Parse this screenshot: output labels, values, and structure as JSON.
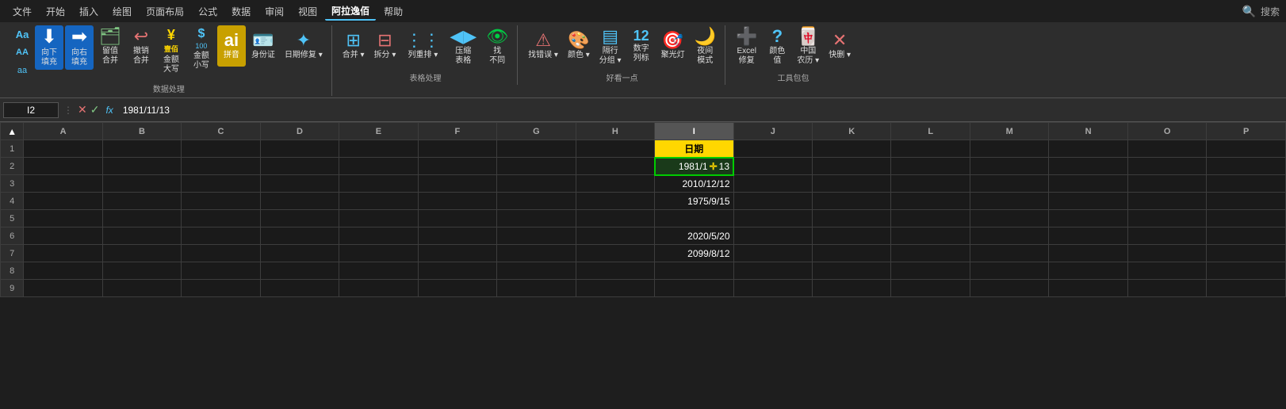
{
  "menubar": {
    "items": [
      "文件",
      "开始",
      "插入",
      "绘图",
      "页面布局",
      "公式",
      "数据",
      "审阅",
      "视图",
      "阿拉逸佰",
      "帮助"
    ],
    "active": "阿拉逸佰",
    "search_placeholder": "搜索"
  },
  "ribbon": {
    "groups": [
      {
        "label": "数据处理",
        "buttons": [
          {
            "id": "fill-down",
            "icon": "⬇",
            "label": "向下\n填充",
            "color": "blue",
            "size": "large"
          },
          {
            "id": "fill-right",
            "icon": "➡",
            "label": "向右\n填充",
            "color": "blue",
            "size": "large"
          },
          {
            "id": "retain-merge",
            "icon": "📋",
            "label": "留值\n合并",
            "color": "green",
            "size": "large"
          },
          {
            "id": "undo-merge",
            "icon": "↩",
            "label": "撤销\n合并",
            "color": "red",
            "size": "large"
          },
          {
            "id": "amount-upper",
            "icon": "¥",
            "label": "金额\n大写",
            "color": "",
            "size": "large"
          },
          {
            "id": "amount-lower",
            "icon": "$",
            "label": "金额\n小写",
            "color": "",
            "size": "large"
          },
          {
            "id": "pinyin",
            "icon": "ai",
            "label": "拼音",
            "color": "gold",
            "size": "large",
            "gold": true
          },
          {
            "id": "id-card",
            "icon": "🪪",
            "label": "身份证",
            "color": "blue",
            "size": "large"
          },
          {
            "id": "date-fix",
            "icon": "✨",
            "label": "日期修复",
            "color": "blue",
            "size": "large",
            "has_arrow": true
          }
        ]
      },
      {
        "label": "表格处理",
        "buttons": [
          {
            "id": "merge",
            "icon": "⊞",
            "label": "合并",
            "color": "blue",
            "size": "large",
            "has_arrow": true
          },
          {
            "id": "split",
            "icon": "⊟",
            "label": "拆分",
            "color": "red",
            "size": "large",
            "has_arrow": true
          },
          {
            "id": "col-reorder",
            "icon": "⋮",
            "label": "列重排",
            "color": "blue",
            "size": "large",
            "has_arrow": true
          },
          {
            "id": "compress",
            "icon": "◀▶",
            "label": "压缩\n表格",
            "color": "blue",
            "size": "large"
          },
          {
            "id": "find-diff",
            "icon": "👁",
            "label": "找\n不同",
            "color": "green",
            "size": "large"
          }
        ]
      },
      {
        "label": "好看一点",
        "buttons": [
          {
            "id": "find-error",
            "icon": "🔍",
            "label": "找错误",
            "color": "red",
            "size": "large",
            "has_arrow": true
          },
          {
            "id": "color-scheme",
            "icon": "🎨",
            "label": "颜色",
            "color": "",
            "size": "large",
            "has_arrow": true
          },
          {
            "id": "alt-row",
            "icon": "▤",
            "label": "隔行\n分组",
            "color": "blue",
            "size": "large",
            "has_arrow": true
          },
          {
            "id": "num-label",
            "icon": "12",
            "label": "数字\n列标",
            "color": "blue",
            "size": "large"
          },
          {
            "id": "spotlight",
            "icon": "🎯",
            "label": "聚光灯",
            "color": "",
            "size": "large"
          },
          {
            "id": "night-mode",
            "icon": "🌙",
            "label": "夜间\n模式",
            "color": "",
            "size": "large"
          }
        ]
      },
      {
        "label": "工具包包",
        "buttons": [
          {
            "id": "excel-fix",
            "icon": "📊",
            "label": "Excel\n修复",
            "color": "red",
            "size": "large"
          },
          {
            "id": "color-val",
            "icon": "?",
            "label": "颜色\n值",
            "color": "blue",
            "size": "large"
          },
          {
            "id": "cn-calendar",
            "icon": "🀄",
            "label": "中国\n农历",
            "color": "red",
            "size": "large",
            "has_arrow": true
          },
          {
            "id": "quick-del",
            "icon": "✕",
            "label": "快删",
            "color": "red",
            "size": "large",
            "has_arrow": true
          }
        ]
      }
    ]
  },
  "formula_bar": {
    "cell_ref": "I2",
    "formula": "1981/11/13"
  },
  "sheet": {
    "col_headers": [
      "A",
      "B",
      "C",
      "D",
      "E",
      "F",
      "G",
      "H",
      "I",
      "J",
      "K",
      "L",
      "M",
      "N",
      "O",
      "P"
    ],
    "active_col": "I",
    "rows": [
      {
        "row": 1,
        "cells": {
          "I": {
            "value": "日期",
            "type": "header"
          }
        }
      },
      {
        "row": 2,
        "cells": {
          "I": {
            "value": "1981/1⊕13",
            "type": "selected"
          }
        }
      },
      {
        "row": 3,
        "cells": {
          "I": {
            "value": "2010/12/12",
            "type": "normal"
          }
        }
      },
      {
        "row": 4,
        "cells": {
          "I": {
            "value": "1975/9/15",
            "type": "normal"
          }
        }
      },
      {
        "row": 5,
        "cells": {
          "I": {
            "value": "",
            "type": "empty"
          }
        }
      },
      {
        "row": 6,
        "cells": {
          "I": {
            "value": "2020/5/20",
            "type": "normal"
          }
        }
      },
      {
        "row": 7,
        "cells": {
          "I": {
            "value": "2099/8/12",
            "type": "normal"
          }
        }
      },
      {
        "row": 8,
        "cells": {
          "I": {
            "value": "",
            "type": "empty"
          }
        }
      },
      {
        "row": 9,
        "cells": {
          "I": {
            "value": "",
            "type": "empty"
          }
        }
      }
    ],
    "col_widths": {
      "A": 95,
      "B": 95,
      "C": 95,
      "D": 95,
      "E": 95,
      "F": 95,
      "G": 95,
      "H": 95,
      "I": 95,
      "J": 95,
      "K": 95,
      "L": 95,
      "M": 95,
      "N": 95,
      "O": 95,
      "P": 95
    }
  }
}
